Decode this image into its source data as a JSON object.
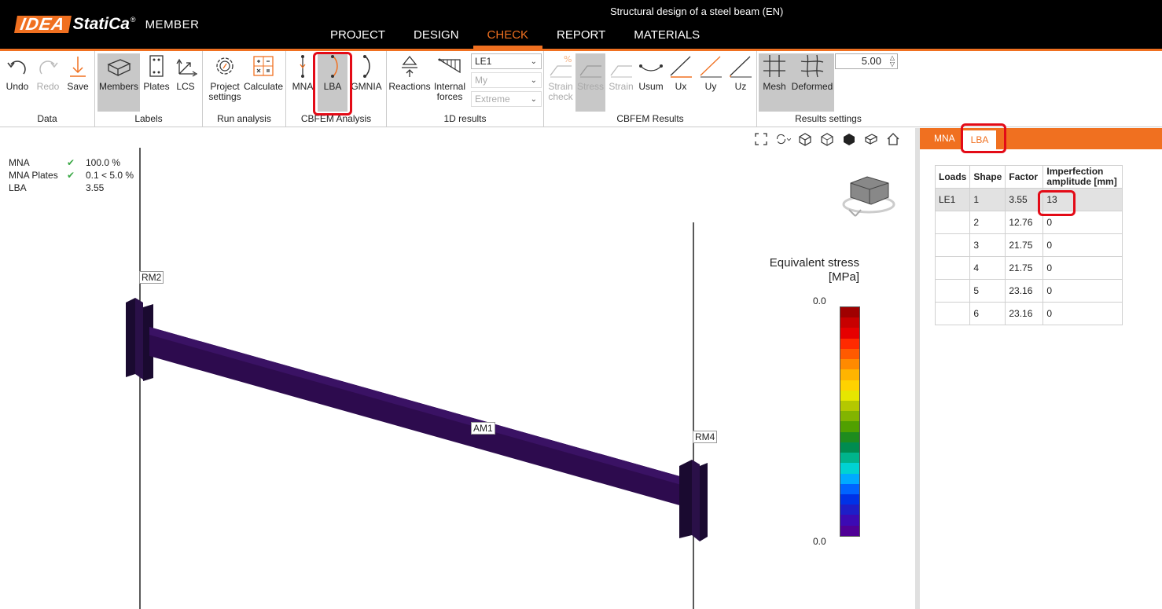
{
  "app": {
    "logo_idea": "IDEA",
    "logo_statica": "StatiCa",
    "logo_reg": "®",
    "module": "MEMBER",
    "document_title": "Structural design of a steel beam (EN)"
  },
  "main_menu": [
    {
      "label": "PROJECT",
      "active": false
    },
    {
      "label": "DESIGN",
      "active": false
    },
    {
      "label": "CHECK",
      "active": true
    },
    {
      "label": "REPORT",
      "active": false
    },
    {
      "label": "MATERIALS",
      "active": false
    }
  ],
  "ribbon": {
    "data": {
      "label": "Data",
      "undo": "Undo",
      "redo": "Redo",
      "save": "Save"
    },
    "labels": {
      "label": "Labels",
      "members": "Members",
      "plates": "Plates",
      "lcs": "LCS"
    },
    "run": {
      "label": "Run analysis",
      "project_settings_1": "Project",
      "project_settings_2": "settings",
      "calculate": "Calculate"
    },
    "cbfem_analysis": {
      "label": "CBFEM Analysis",
      "mna": "MNA",
      "lba": "LBA",
      "gmnia": "GMNIA"
    },
    "results_1d": {
      "label": "1D results",
      "reactions": "Reactions",
      "internal_1": "Internal",
      "internal_2": "forces",
      "load_effect": "LE1",
      "component": "My",
      "extreme": "Extreme"
    },
    "cbfem_results": {
      "label": "CBFEM Results",
      "strain_check_1": "Strain",
      "strain_check_2": "check",
      "stress": "Stress",
      "strain": "Strain",
      "usum": "Usum",
      "ux": "Ux",
      "uy": "Uy",
      "uz": "Uz"
    },
    "results_settings": {
      "label": "Results settings",
      "mesh": "Mesh",
      "deformed": "Deformed",
      "scale_value": "5.00"
    }
  },
  "viewport": {
    "summary": [
      {
        "key": "MNA",
        "check": true,
        "value": "100.0 %"
      },
      {
        "key": "MNA Plates",
        "check": true,
        "value": "0.1 < 5.0 %"
      },
      {
        "key": "LBA",
        "check": false,
        "value": "3.55"
      }
    ],
    "member_labels": {
      "rm2": "RM2",
      "rm4": "RM4",
      "am1": "AM1"
    },
    "legend": {
      "title_1": "Equivalent stress",
      "title_2": "[MPa]",
      "max": "0.0",
      "min": "0.0",
      "colors": [
        "#a00000",
        "#c80000",
        "#e60000",
        "#ff2a00",
        "#ff5a00",
        "#ff8a00",
        "#ffb400",
        "#ffd200",
        "#e6e600",
        "#b4c800",
        "#82b400",
        "#50a000",
        "#1e8c1e",
        "#008c50",
        "#00b48c",
        "#00d2d2",
        "#00aaff",
        "#0064ff",
        "#0032e6",
        "#1e1ec8",
        "#3c0ab4",
        "#500096"
      ]
    }
  },
  "panel": {
    "tabs": [
      {
        "label": "MNA",
        "active": false
      },
      {
        "label": "LBA",
        "active": true
      }
    ],
    "table": {
      "headers": [
        "Loads",
        "Shape",
        "Factor",
        "Imperfection amplitude [mm]"
      ],
      "rows": [
        [
          "LE1",
          "1",
          "3.55",
          "13"
        ],
        [
          "",
          "2",
          "12.76",
          "0"
        ],
        [
          "",
          "3",
          "21.75",
          "0"
        ],
        [
          "",
          "4",
          "21.75",
          "0"
        ],
        [
          "",
          "5",
          "23.16",
          "0"
        ],
        [
          "",
          "6",
          "23.16",
          "0"
        ]
      ]
    }
  }
}
